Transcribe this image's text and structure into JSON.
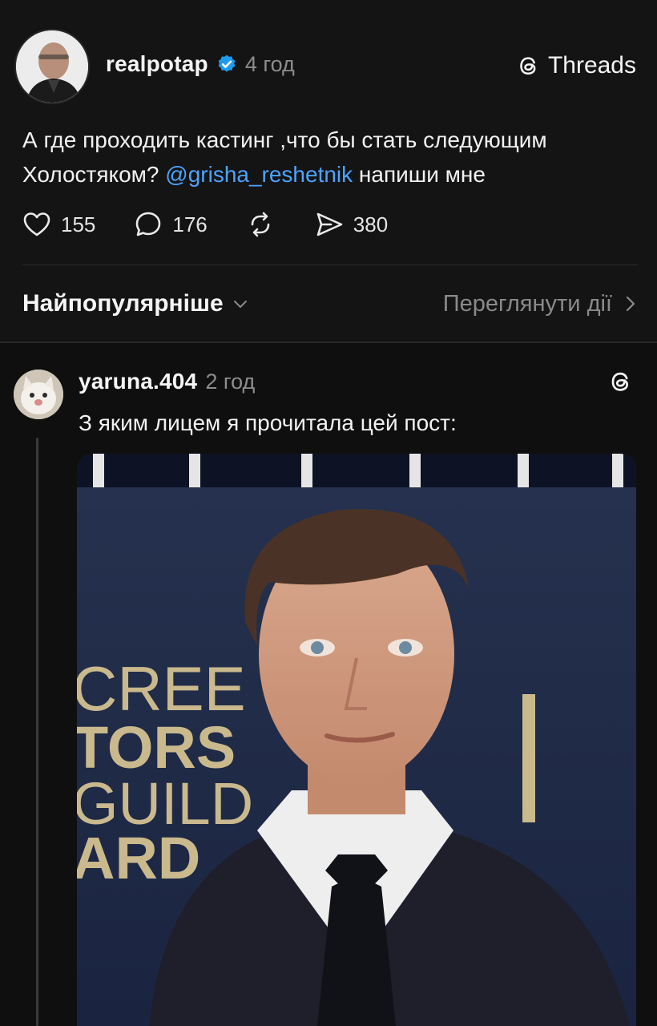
{
  "post": {
    "username": "realpotap",
    "time": "4 год",
    "brand_label": "Threads",
    "text_before": "А где проходить кастинг ,что бы стать следующим Холостяком? ",
    "mention": "@grisha_reshetnik",
    "text_after": " напиши мне",
    "likes": "155",
    "comments": "176",
    "shares": "380"
  },
  "sort": {
    "label": "Найпопулярніше",
    "activity_label": "Переглянути дії"
  },
  "reply": {
    "username": "yaruna.404",
    "time": "2 год",
    "text": "З яким лицем я прочитала цей пост:",
    "media_sign_lines": [
      "CREE",
      "TORS",
      "GUILD",
      "ARD"
    ]
  },
  "icons": {
    "verified": "verified-badge-icon",
    "brand": "threads-logo-icon",
    "like": "heart-icon",
    "comment": "comment-bubble-icon",
    "repost": "repost-icon",
    "share": "send-icon",
    "dropdown": "chevron-down-icon",
    "activity": "chevron-right-icon"
  },
  "colors": {
    "background": "#0f0f0f",
    "surface": "#141414",
    "mention": "#4da3ff",
    "verified": "#1d9bf0",
    "muted": "#8a8a8a"
  }
}
